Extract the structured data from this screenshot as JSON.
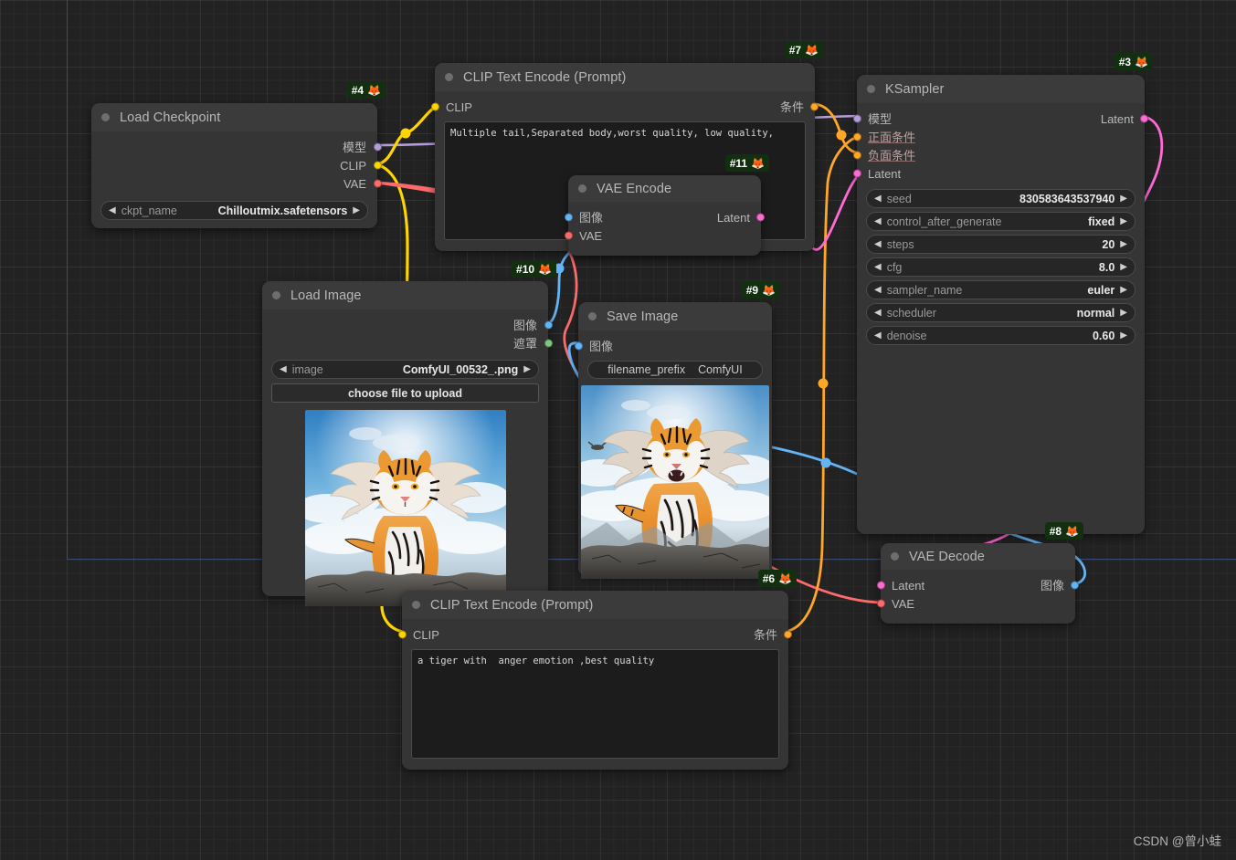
{
  "watermark": "CSDN @曾小蛙",
  "canvas": {
    "grid_color": "#2a2a2a",
    "background": "#222222",
    "guide_color": "#3b4c74"
  },
  "wire_colors": {
    "model": "#b39ddb",
    "clip": "#ffd500",
    "vae": "#ff6b6b",
    "conditioning": "#ffa726",
    "latent": "#ff6ad5",
    "image": "#64b5f6",
    "mask": "#81c784"
  },
  "nodes": [
    {
      "id": "load-checkpoint",
      "badge": "#4",
      "title": "Load Checkpoint",
      "outputs": [
        {
          "label": "模型",
          "color": "#b39ddb"
        },
        {
          "label": "CLIP",
          "color": "#ffd500"
        },
        {
          "label": "VAE",
          "color": "#ff6b6b"
        }
      ],
      "widgets": [
        {
          "name": "ckpt_name",
          "value": "Chilloutmix.safetensors"
        }
      ]
    },
    {
      "id": "clip-text-encode-negative",
      "badge": "#7",
      "title": "CLIP Text Encode (Prompt)",
      "inputs": [
        {
          "label": "CLIP",
          "color": "#ffd500"
        }
      ],
      "outputs": [
        {
          "label": "条件",
          "color": "#ffa726"
        }
      ],
      "text": "Multiple tail,Separated body,worst quality, low quality,"
    },
    {
      "id": "vae-encode",
      "badge": "#11",
      "title": "VAE Encode",
      "inputs": [
        {
          "label": "图像",
          "color": "#64b5f6"
        },
        {
          "label": "VAE",
          "color": "#ff6b6b"
        }
      ],
      "outputs": [
        {
          "label": "Latent",
          "color": "#ff6ad5"
        }
      ]
    },
    {
      "id": "ksampler",
      "badge": "#3",
      "title": "KSampler",
      "inputs": [
        {
          "label": "模型",
          "color": "#b39ddb"
        },
        {
          "label": "正面条件",
          "color": "#ffa726"
        },
        {
          "label": "负面条件",
          "color": "#ffa726"
        },
        {
          "label": "Latent",
          "color": "#ff6ad5"
        }
      ],
      "outputs": [
        {
          "label": "Latent",
          "color": "#ff6ad5"
        }
      ],
      "widgets": [
        {
          "name": "seed",
          "value": "830583643537940"
        },
        {
          "name": "control_after_generate",
          "value": "fixed"
        },
        {
          "name": "steps",
          "value": "20"
        },
        {
          "name": "cfg",
          "value": "8.0"
        },
        {
          "name": "sampler_name",
          "value": "euler"
        },
        {
          "name": "scheduler",
          "value": "normal"
        },
        {
          "name": "denoise",
          "value": "0.60"
        }
      ]
    },
    {
      "id": "load-image",
      "badge": "#10",
      "title": "Load Image",
      "outputs": [
        {
          "label": "图像",
          "color": "#64b5f6"
        },
        {
          "label": "遮罩",
          "color": "#81c784"
        }
      ],
      "widgets": [
        {
          "name": "image",
          "value": "ComfyUI_00532_.png"
        }
      ],
      "upload_button": "choose file to upload",
      "preview_alt": "winged tiger standing on rocks under blue sky"
    },
    {
      "id": "save-image",
      "badge": "#9",
      "title": "Save Image",
      "inputs": [
        {
          "label": "图像",
          "color": "#64b5f6"
        }
      ],
      "widgets": [
        {
          "name": "filename_prefix",
          "value": "ComfyUI"
        }
      ],
      "preview_alt": "winged tiger sitting on rocks, roaring"
    },
    {
      "id": "clip-text-encode-positive",
      "badge": "#6",
      "title": "CLIP Text Encode (Prompt)",
      "inputs": [
        {
          "label": "CLIP",
          "color": "#ffd500"
        }
      ],
      "outputs": [
        {
          "label": "条件",
          "color": "#ffa726"
        }
      ],
      "text": "a tiger with  anger emotion ,best quality"
    },
    {
      "id": "vae-decode",
      "badge": "#8",
      "title": "VAE Decode",
      "inputs": [
        {
          "label": "Latent",
          "color": "#ff6ad5"
        },
        {
          "label": "VAE",
          "color": "#ff6b6b"
        }
      ],
      "outputs": [
        {
          "label": "图像",
          "color": "#64b5f6"
        }
      ]
    }
  ],
  "glyphs": {
    "arrow_left": "◀",
    "arrow_right": "▶",
    "fox": "🦊"
  }
}
